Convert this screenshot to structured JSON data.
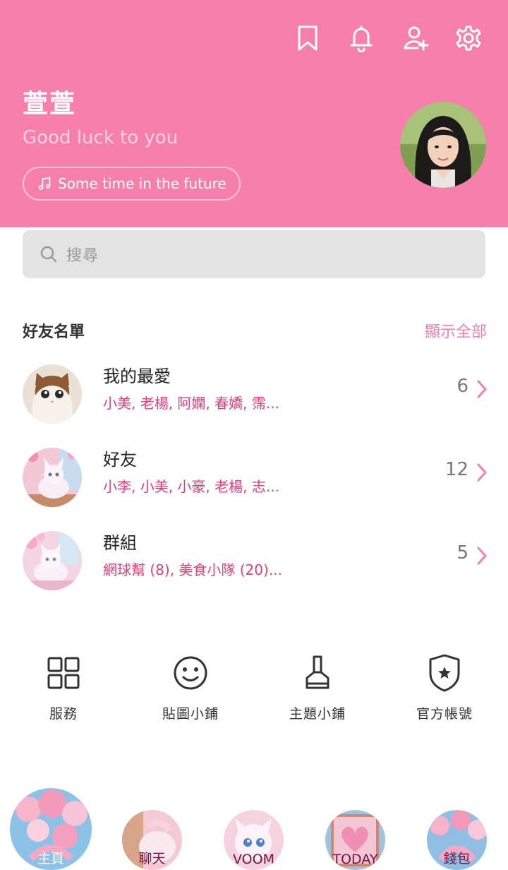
{
  "theme": {
    "accent": "#f77fab",
    "highlight": "#e43d79"
  },
  "top_icons": [
    "bookmark-icon",
    "bell-icon",
    "add-friend-icon",
    "settings-icon"
  ],
  "profile": {
    "name": "萱萱",
    "status_message": "Good luck to you",
    "music": "Some time in the future"
  },
  "search": {
    "placeholder": "搜尋"
  },
  "friends_section": {
    "title": "好友名單",
    "show_all": "顯示全部",
    "rows": [
      {
        "title": "我的最愛",
        "subtitle": "小美, 老楊, 阿嫻, 春嬌, 霈...",
        "count": "6"
      },
      {
        "title": "好友",
        "subtitle": "小李, 小美, 小豪, 老楊, 志...",
        "count": "12"
      },
      {
        "title": "群組",
        "subtitle": "網球幫 (8), 美食小隊 (20)...",
        "count": "5"
      }
    ]
  },
  "services": [
    {
      "label": "服務",
      "icon": "grid-icon"
    },
    {
      "label": "貼圖小鋪",
      "icon": "smiley-icon"
    },
    {
      "label": "主題小鋪",
      "icon": "brush-icon"
    },
    {
      "label": "官方帳號",
      "icon": "shield-star-icon"
    }
  ],
  "bottom_nav": [
    {
      "label": "主頁",
      "active": true
    },
    {
      "label": "聊天"
    },
    {
      "label": "VOOM"
    },
    {
      "label": "TODAY"
    },
    {
      "label": "錢包"
    }
  ]
}
